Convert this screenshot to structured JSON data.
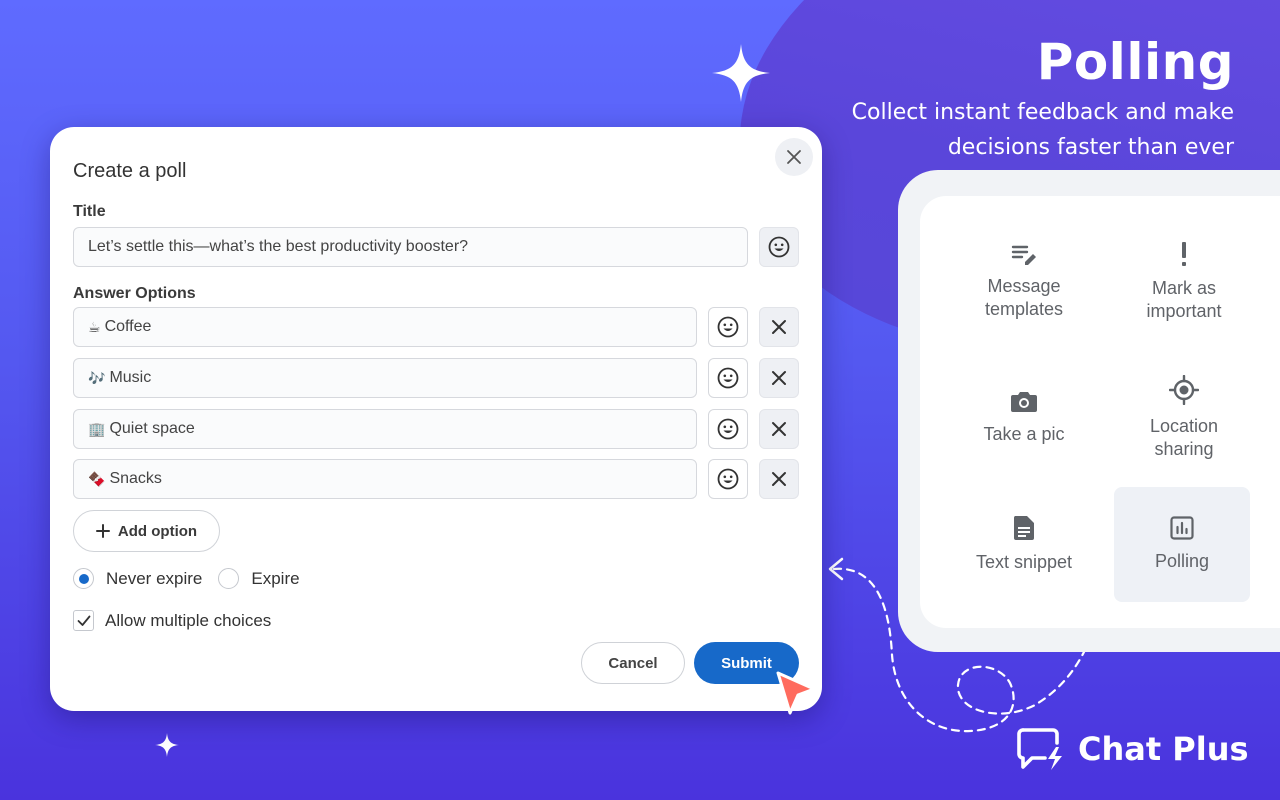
{
  "hero": {
    "title": "Polling",
    "subtitle": "Collect instant feedback and make decisions faster than ever"
  },
  "dialog": {
    "title": "Create a poll",
    "title_label": "Title",
    "title_value": "Let’s settle this—what’s the best productivity booster?",
    "answers_label": "Answer Options",
    "options": [
      {
        "emoji": "☕",
        "text": "Coffee"
      },
      {
        "emoji": "🎶",
        "text": "Music"
      },
      {
        "emoji": "🏢",
        "text": "Quiet space"
      },
      {
        "emoji": "🍫",
        "text": "Snacks"
      }
    ],
    "add_option_label": "Add option",
    "expiry": {
      "never_label": "Never expire",
      "expire_label": "Expire",
      "selected": "never"
    },
    "allow_multiple_label": "Allow multiple choices",
    "allow_multiple_checked": true,
    "cancel_label": "Cancel",
    "submit_label": "Submit"
  },
  "panel": {
    "tiles": [
      {
        "label": "Message templates",
        "icon": "edit-list-icon"
      },
      {
        "label": "Mark as important",
        "icon": "exclamation-icon"
      },
      {
        "label": "Take a pic",
        "icon": "camera-icon"
      },
      {
        "label": "Location sharing",
        "icon": "location-target-icon"
      },
      {
        "label": "Text snippet",
        "icon": "document-icon"
      },
      {
        "label": "Polling",
        "icon": "bar-chart-icon",
        "active": true
      }
    ]
  },
  "brand": {
    "name": "Chat Plus",
    "icon": "chat-bolt-icon"
  },
  "colors": {
    "accent": "#1769c9",
    "cursor": "#ff6b5e",
    "background": "#5458f0"
  }
}
